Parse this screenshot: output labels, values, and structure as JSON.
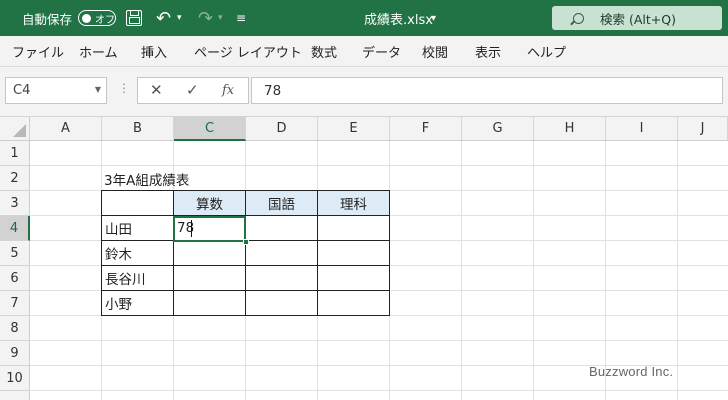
{
  "titlebar": {
    "autosave_label": "自動保存",
    "autosave_toggle": "オフ",
    "filename": "成績表.xlsx",
    "search_placeholder": "検索 (Alt+Q)",
    "accent_color": "#217346"
  },
  "ribbon": {
    "tabs": [
      "ファイル",
      "ホーム",
      "挿入",
      "ページ レイアウト",
      "数式",
      "データ",
      "校閲",
      "表示",
      "ヘルプ"
    ]
  },
  "formula_bar": {
    "name_box": "C4",
    "formula": "78",
    "fx": "fx"
  },
  "grid": {
    "columns": [
      "A",
      "B",
      "C",
      "D",
      "E",
      "F",
      "G",
      "H",
      "I",
      "J"
    ],
    "rows": [
      "1",
      "2",
      "3",
      "4",
      "5",
      "6",
      "7",
      "8",
      "9",
      "10"
    ],
    "active_cell": "C4"
  },
  "sheet": {
    "title": "3年A組成績表",
    "headers": [
      "算数",
      "国語",
      "理科"
    ],
    "students": [
      "山田",
      "鈴木",
      "長谷川",
      "小野"
    ],
    "c4_value": "78",
    "header_fill": "#ddebf7"
  },
  "watermark": "Buzzword Inc."
}
